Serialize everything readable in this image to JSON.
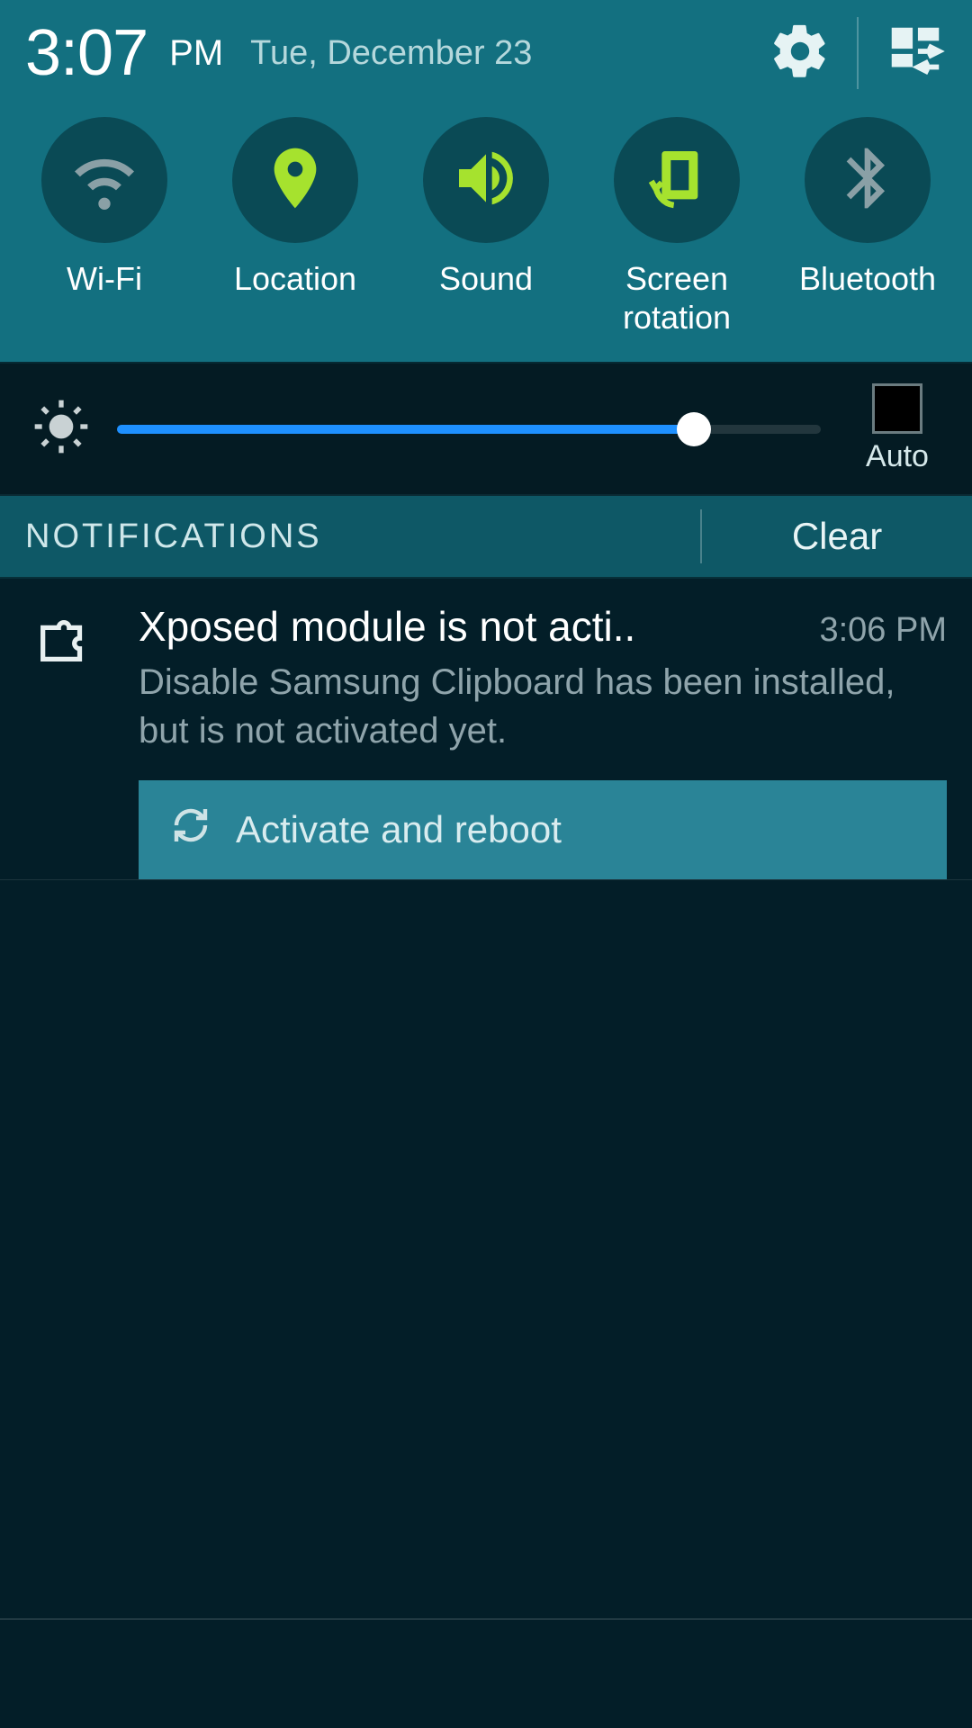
{
  "status": {
    "time": "3:07",
    "ampm": "PM",
    "date": "Tue, December 23"
  },
  "quick_settings": [
    {
      "id": "wifi",
      "label": "Wi-Fi",
      "active": false
    },
    {
      "id": "location",
      "label": "Location",
      "active": true
    },
    {
      "id": "sound",
      "label": "Sound",
      "active": true
    },
    {
      "id": "rotation",
      "label": "Screen\nrotation",
      "active": true
    },
    {
      "id": "bluetooth",
      "label": "Bluetooth",
      "active": false
    }
  ],
  "brightness": {
    "percent": 82,
    "auto_label": "Auto",
    "auto_checked": false
  },
  "notifications_bar": {
    "title": "NOTIFICATIONS",
    "clear_label": "Clear"
  },
  "notifications": [
    {
      "title": "Xposed module is not acti..",
      "time": "3:06 PM",
      "subtitle": "Disable Samsung Clipboard has been installed, but is not activated yet.",
      "action_label": "Activate and reboot"
    }
  ],
  "colors": {
    "active": "#a6e22e",
    "inactive": "#8aa0a6"
  }
}
